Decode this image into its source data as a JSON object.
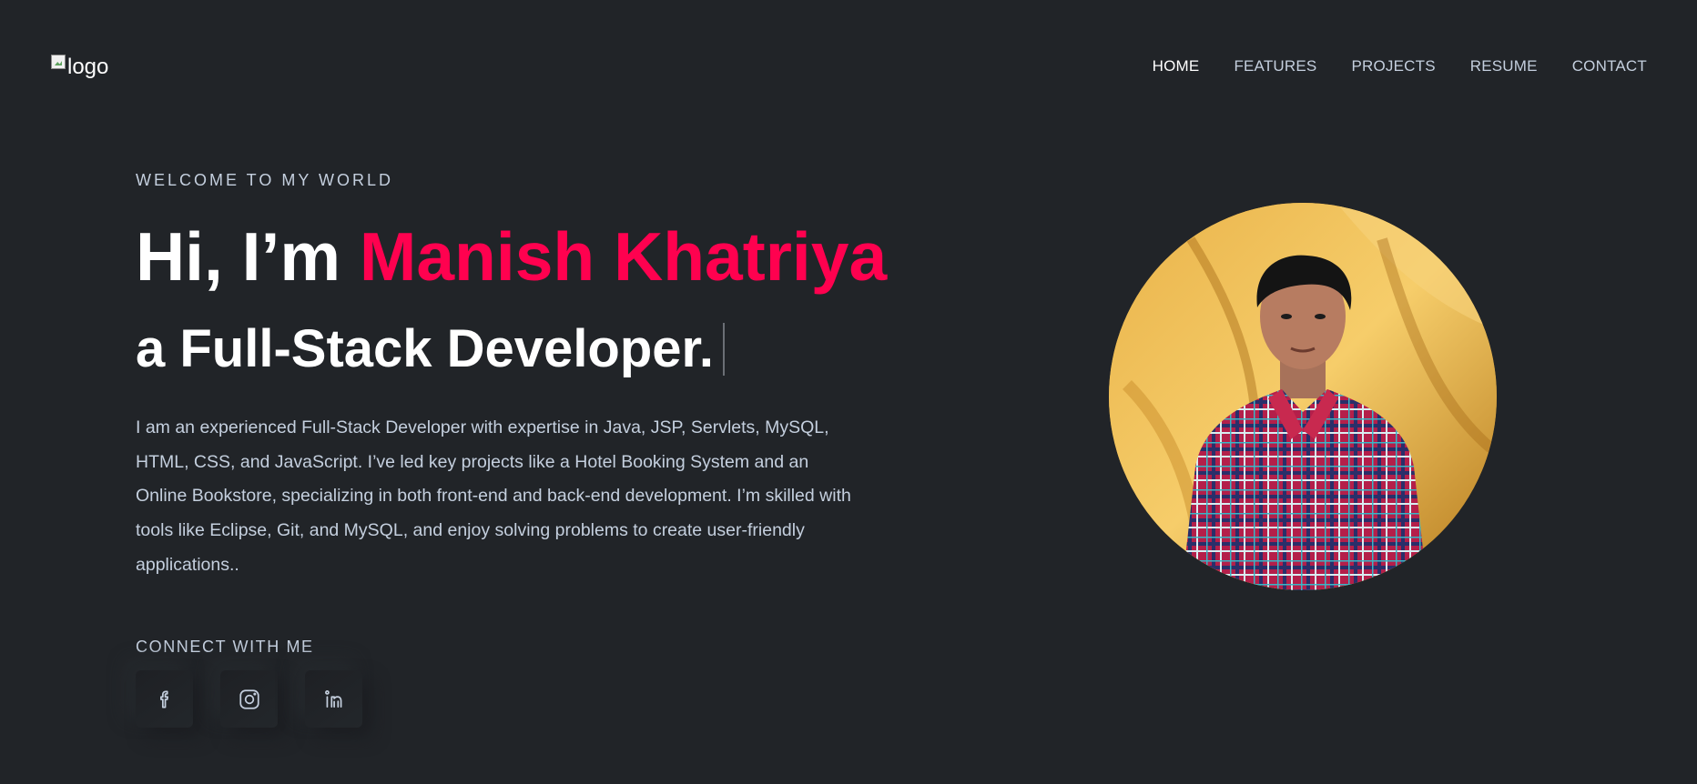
{
  "header": {
    "logo_alt": "logo",
    "nav": [
      {
        "label": "HOME",
        "active": true
      },
      {
        "label": "FEATURES",
        "active": false
      },
      {
        "label": "PROJECTS",
        "active": false
      },
      {
        "label": "RESUME",
        "active": false
      },
      {
        "label": "CONTACT",
        "active": false
      }
    ]
  },
  "hero": {
    "welcome": "WELCOME TO MY WORLD",
    "greeting": "Hi, I’m ",
    "name": "Manish Khatriya",
    "role": "a Full-Stack Developer.",
    "description": "I am an experienced Full-Stack Developer with expertise in Java, JSP, Servlets, MySQL, HTML, CSS, and JavaScript. I’ve led key projects like a Hotel Booking System and an Online Bookstore, specializing in both front-end and back-end development. I’m skilled with tools like Eclipse, Git, and MySQL, and enjoy solving problems to create user-friendly applications..",
    "connect_label": "CONNECT WITH ME",
    "socials": [
      {
        "icon": "facebook-icon"
      },
      {
        "icon": "instagram-icon"
      },
      {
        "icon": "linkedin-icon"
      }
    ]
  },
  "colors": {
    "background": "#212428",
    "accent": "#ff014f",
    "text": "#c4cfde",
    "heading": "#ffffff"
  }
}
